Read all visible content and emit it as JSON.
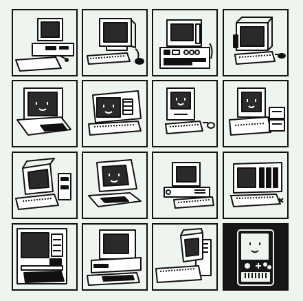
{
  "icon_set": {
    "colors": {
      "ink": "#111111",
      "paper": "#eef4ee",
      "screen": "#2a2a2a",
      "selected_tile": "#161616"
    },
    "tiles": [
      {
        "icon": "desktop-pc-mouse-icon"
      },
      {
        "icon": "crt-monitor-keyboard-mouse-icon"
      },
      {
        "icon": "tower-workstation-icon"
      },
      {
        "icon": "compact-pc-mouse-icon"
      },
      {
        "icon": "smiling-computer-keyboard-icon"
      },
      {
        "icon": "smiling-terminal-icon"
      },
      {
        "icon": "smiling-all-in-one-mouse-icon"
      },
      {
        "icon": "smiling-pc-disk-drives-icon"
      },
      {
        "icon": "monitor-with-side-drive-icon"
      },
      {
        "icon": "smiling-home-computer-icon"
      },
      {
        "icon": "desktop-keyboard-icon"
      },
      {
        "icon": "workstation-slot-panel-icon"
      },
      {
        "icon": "console-computer-icon"
      },
      {
        "icon": "pc-keyboard-icon"
      },
      {
        "icon": "laptop-terminal-icon"
      },
      {
        "icon": "handheld-smiling-computer-icon",
        "selected": true
      }
    ]
  }
}
